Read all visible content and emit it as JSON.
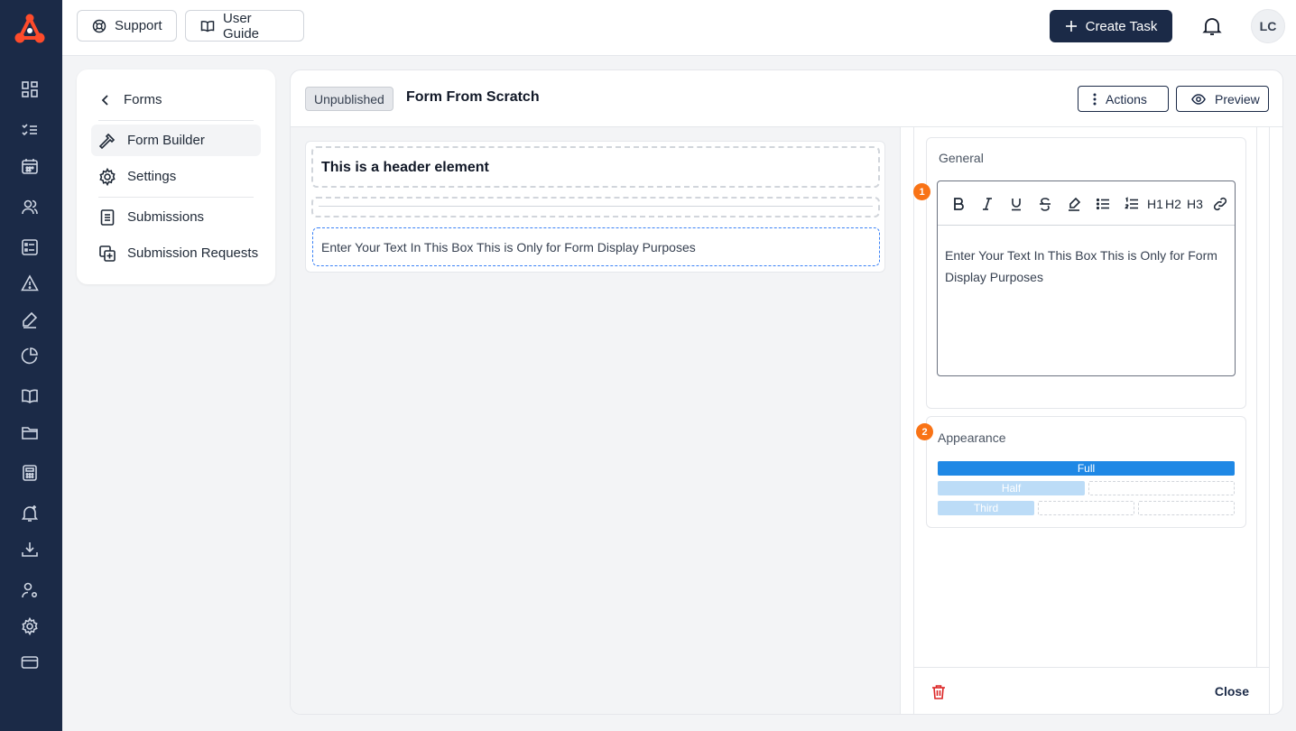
{
  "topbar": {
    "support_label": "Support",
    "guide_label": "User Guide",
    "create_label": "Create Task",
    "avatar_initials": "LC"
  },
  "nav": {
    "back_label": "Forms",
    "items": [
      {
        "label": "Form Builder",
        "icon": "hammer-icon",
        "active": true
      },
      {
        "label": "Settings",
        "icon": "gear-icon",
        "active": false
      },
      {
        "label": "Submissions",
        "icon": "document-icon",
        "active": false
      },
      {
        "label": "Submission Requests",
        "icon": "copy-plus-icon",
        "active": false
      }
    ]
  },
  "form": {
    "status": "Unpublished",
    "title": "Form From Scratch",
    "actions_label": "Actions",
    "preview_label": "Preview",
    "elements": {
      "header_text": "This is a header element",
      "text_box": "Enter Your Text In This Box This is Only for Form Display Purposes"
    }
  },
  "properties": {
    "general_label": "General",
    "step_general": "1",
    "editor_text": "Enter Your Text In This Box This is Only for Form Display Purposes",
    "heading_buttons": [
      "H1",
      "H2",
      "H3"
    ],
    "appearance_label": "Appearance",
    "step_appearance": "2",
    "width_options": {
      "full": "Full",
      "half": "Half",
      "third": "Third"
    },
    "close_label": "Close"
  },
  "colors": {
    "navy": "#1b2a47",
    "accent_orange": "#f97316",
    "accent_blue": "#1f88e5",
    "delete_red": "#dc2626"
  }
}
